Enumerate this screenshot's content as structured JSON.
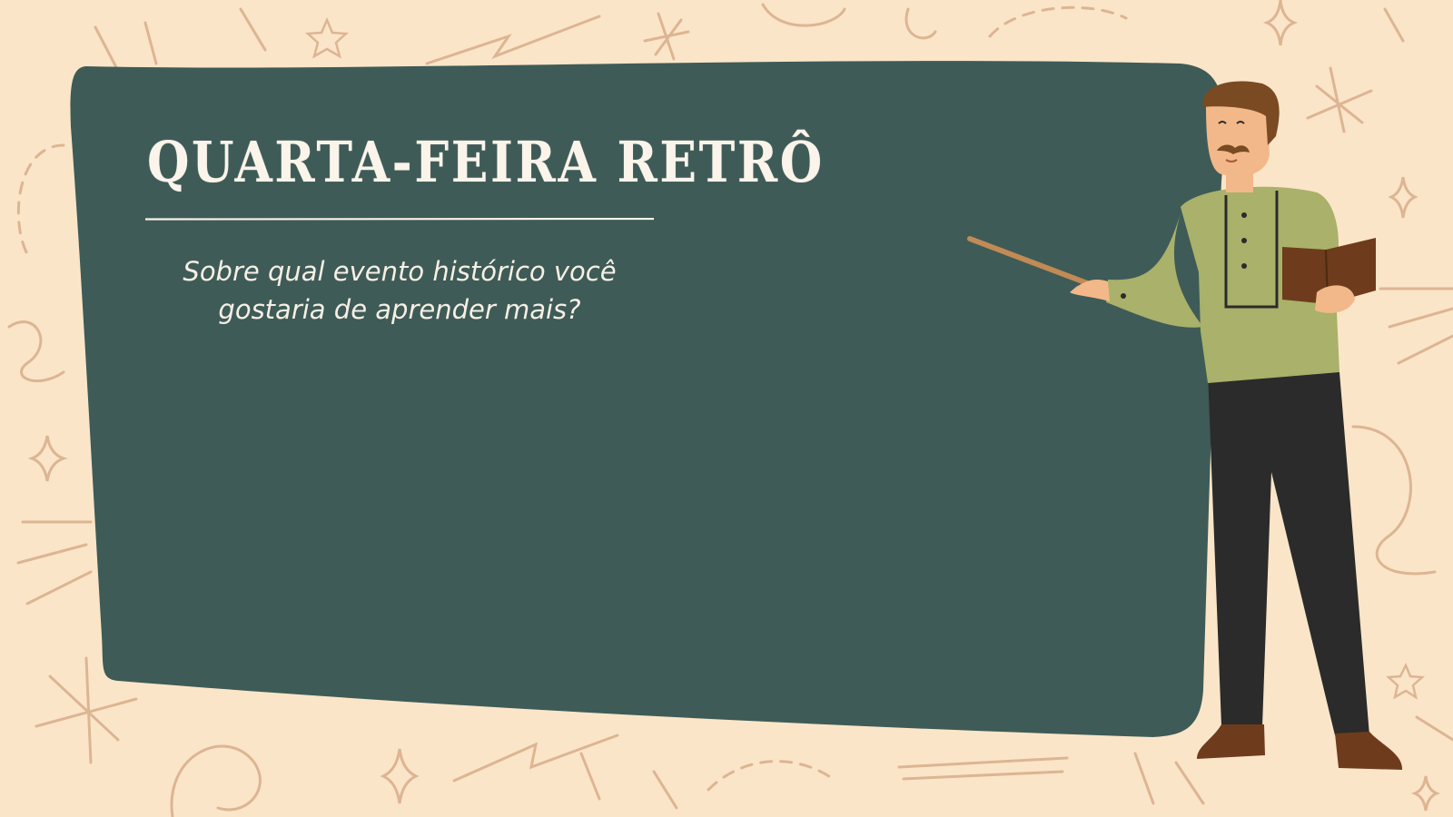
{
  "slide": {
    "title": "QUARTA-FEIRA RETRÔ",
    "question": "Sobre qual evento histórico você gostaria de aprender mais?"
  },
  "colors": {
    "background": "#fbe5c8",
    "doodles": "#ddb593",
    "chalkboard": "#3e5b57",
    "chalk_text": "#fbf4ea",
    "shirt": "#a9b16a",
    "trousers": "#2b2b2b",
    "hair": "#7a4a22",
    "skin": "#f2b889",
    "book": "#6e3c1c",
    "pointer": "#c28a55"
  },
  "icons": [
    "doodle-star-icon",
    "doodle-sparkle-icon",
    "doodle-asterisk-icon",
    "doodle-swirl-icon"
  ]
}
